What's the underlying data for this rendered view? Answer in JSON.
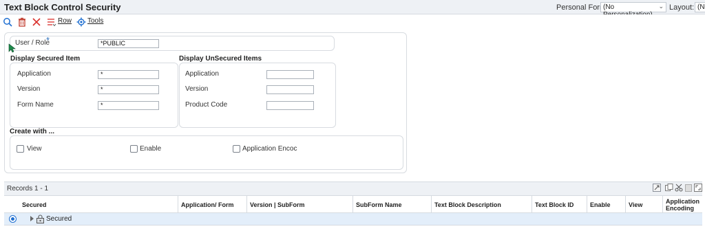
{
  "header": {
    "title": "Text Block Control Security",
    "personal_form_label": "Personal Form:",
    "personal_form_value": "(No Personalization)",
    "layout_label": "Layout:",
    "layout_value": "(No"
  },
  "toolbar": {
    "row_label": "Row",
    "tools_label": "Tools",
    "icons": [
      "search-icon",
      "delete-icon",
      "cancel-icon",
      "row-menu-icon",
      "tools-gear-icon"
    ]
  },
  "form": {
    "user_role": {
      "label": "User / Role",
      "value": "*PUBLIC",
      "required_mark": "*"
    },
    "secured": {
      "heading": "Display Secured Item",
      "fields": [
        {
          "label": "Application",
          "value": "*"
        },
        {
          "label": "Version",
          "value": "*"
        },
        {
          "label": "Form Name",
          "value": "*"
        }
      ]
    },
    "unsecured": {
      "heading": "Display UnSecured Items",
      "fields": [
        {
          "label": "Application",
          "value": ""
        },
        {
          "label": "Version",
          "value": ""
        },
        {
          "label": "Product Code",
          "value": ""
        }
      ]
    },
    "create_with": {
      "heading": "Create with ...",
      "options": [
        {
          "label": "View",
          "checked": false
        },
        {
          "label": "Enable",
          "checked": false
        },
        {
          "label": "Application Encoc",
          "checked": false
        }
      ]
    }
  },
  "grid": {
    "records_label": "Records 1 - 1",
    "columns": [
      "Secured",
      "Application/ Form",
      "Version | SubForm",
      "SubForm Name",
      "Text Block Description",
      "Text Block ID",
      "Enable",
      "View",
      "Application Encoding"
    ],
    "rows": [
      {
        "label": "Secured",
        "selected": true
      }
    ]
  },
  "colors": {
    "accent": "#1f6fd1",
    "selected_row": "#e3eefa",
    "header_bg": "#eef1f5"
  }
}
